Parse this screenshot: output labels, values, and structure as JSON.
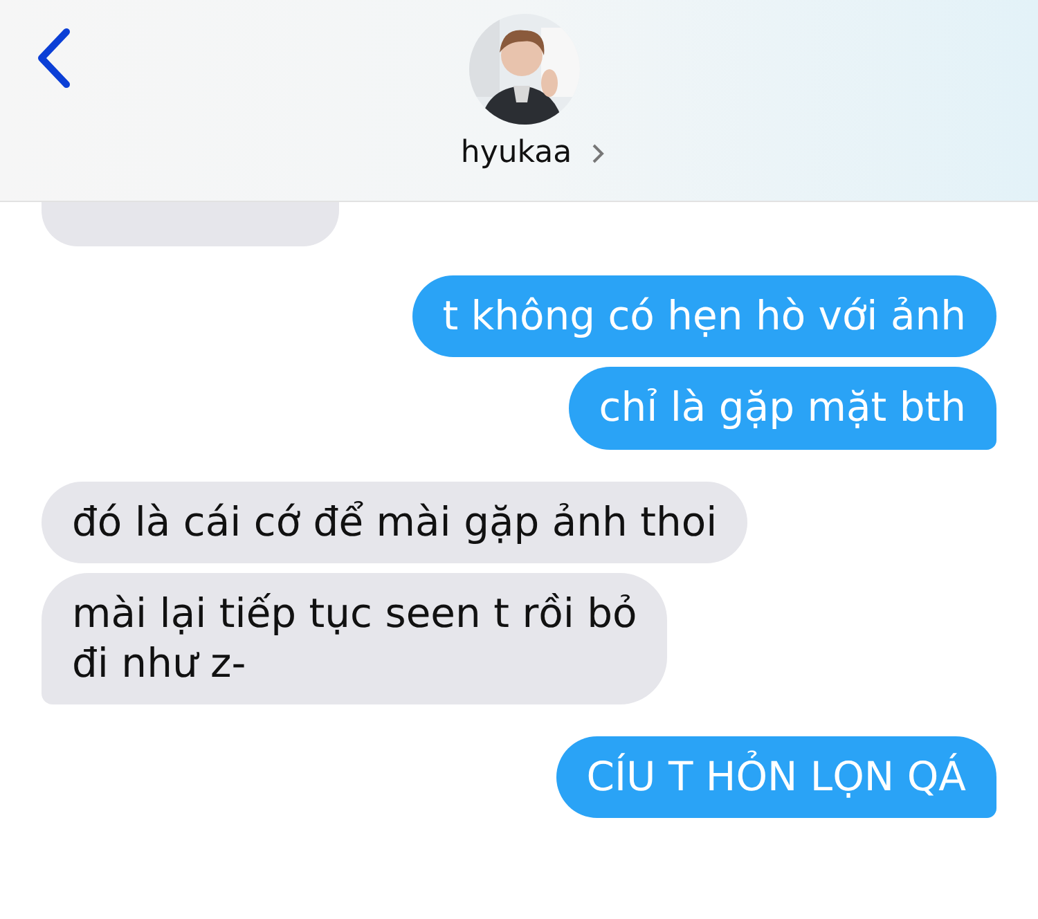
{
  "header": {
    "contact_name": "hyukaa"
  },
  "messages": [
    {
      "kind": "sent",
      "tail": false,
      "text": "t không có hẹn hò với ảnh"
    },
    {
      "kind": "sent",
      "tail": true,
      "text": "chỉ là gặp mặt bth"
    },
    {
      "kind": "received",
      "tail": false,
      "text": "đó là cái cớ để mài gặp ảnh thoi"
    },
    {
      "kind": "received",
      "tail": true,
      "text": "mài lại tiếp tục seen t rồi bỏ\nđi như z-"
    },
    {
      "kind": "sent",
      "tail": true,
      "text": "CÍU T HỎN LỌN QÁ"
    }
  ]
}
